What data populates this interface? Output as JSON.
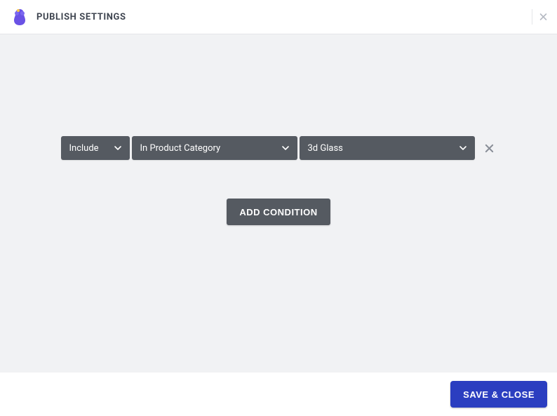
{
  "header": {
    "title": "PUBLISH SETTINGS"
  },
  "condition": {
    "type": "Include",
    "field": "In Product Category",
    "value": "3d Glass"
  },
  "actions": {
    "addCondition": "ADD CONDITION",
    "saveClose": "SAVE & CLOSE"
  }
}
